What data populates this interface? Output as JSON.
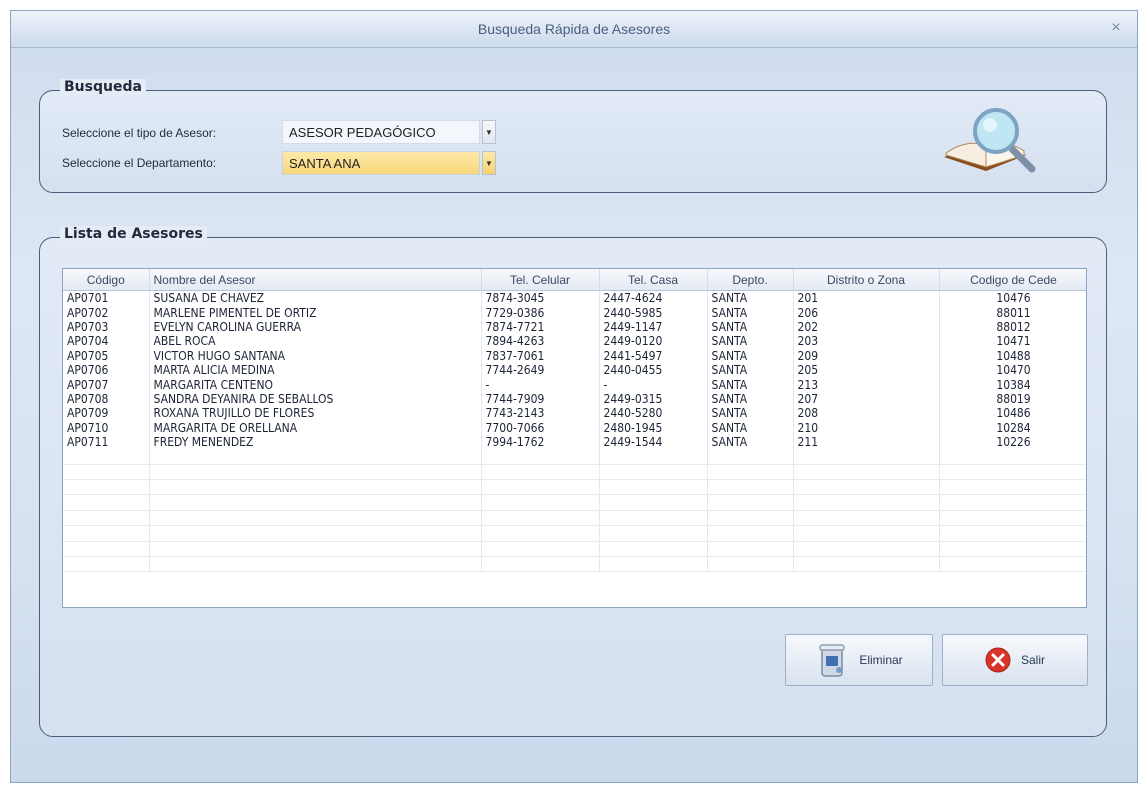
{
  "window": {
    "title": "Busqueda Rápida de Asesores",
    "close_glyph": "×"
  },
  "search_group": {
    "label": "Busqueda",
    "tipo_label": "Seleccione el tipo de Asesor:",
    "tipo_value": "ASESOR PEDAGÓGICO",
    "depto_label": "Seleccione el Departamento:",
    "depto_value": "SANTA ANA",
    "icon": "book-magnifier-icon"
  },
  "list_group": {
    "label": "Lista de Asesores",
    "columns": [
      "Código",
      "Nombre del Asesor",
      "Tel. Celular",
      "Tel. Casa",
      "Depto.",
      "Distrito o Zona",
      "Codigo de Cede"
    ],
    "rows": [
      [
        "AP0701",
        "SUSANA DE CHAVEZ",
        "7874-3045",
        "2447-4624",
        "SANTA",
        "201",
        "10476"
      ],
      [
        "AP0702",
        "MARLENE PIMENTEL DE ORTIZ",
        "7729-0386",
        "2440-5985",
        "SANTA",
        "206",
        "88011"
      ],
      [
        "AP0703",
        "EVELYN CAROLINA GUERRA",
        "7874-7721",
        "2449-1147",
        "SANTA",
        "202",
        "88012"
      ],
      [
        "AP0704",
        "ABEL ROCA",
        "7894-4263",
        "2449-0120",
        "SANTA",
        "203",
        "10471"
      ],
      [
        "AP0705",
        "VICTOR HUGO SANTANA",
        "7837-7061",
        "2441-5497",
        "SANTA",
        "209",
        "10488"
      ],
      [
        "AP0706",
        "MARTA ALICIA MEDINA",
        "7744-2649",
        "2440-0455",
        "SANTA",
        "205",
        "10470"
      ],
      [
        "AP0707",
        "MARGARITA CENTENO",
        "-",
        "-",
        "SANTA",
        "213",
        "10384"
      ],
      [
        "AP0708",
        "SANDRA DEYANIRA DE SEBALLOS",
        "7744-7909",
        "2449-0315",
        "SANTA",
        "207",
        "88019"
      ],
      [
        "AP0709",
        "ROXANA TRUJILLO DE FLORES",
        "7743-2143",
        "2440-5280",
        "SANTA",
        "208",
        "10486"
      ],
      [
        "AP0710",
        "MARGARITA DE ORELLANA",
        "7700-7066",
        "2480-1945",
        "SANTA",
        "210",
        "10284"
      ],
      [
        "AP0711",
        "FREDY MENENDEZ",
        "7994-1762",
        "2449-1544",
        "SANTA",
        "211",
        "10226"
      ]
    ]
  },
  "buttons": {
    "eliminar": {
      "label": "Eliminar",
      "icon": "trash-bin-icon"
    },
    "salir": {
      "label": "Salir",
      "icon": "close-circle-icon"
    }
  },
  "colors": {
    "accent": "#4b5d7a",
    "highlight": "#f8d77a",
    "exit_icon": "#d9342b"
  }
}
